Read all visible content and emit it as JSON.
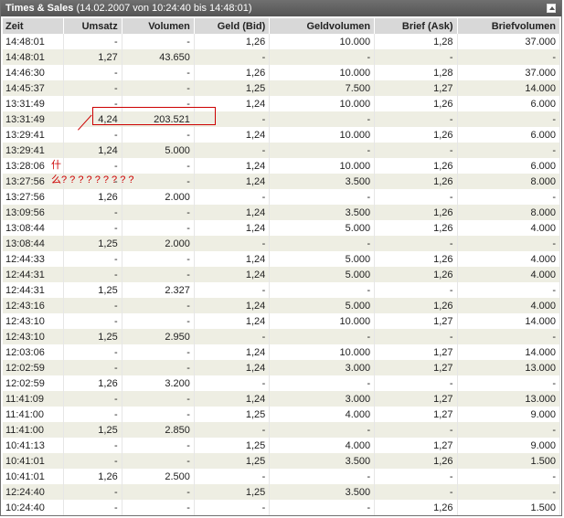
{
  "panel": {
    "title": "Times & Sales",
    "range": "(14.02.2007 von 10:24:40 bis 14:48:01)",
    "headers": [
      "Zeit",
      "Umsatz",
      "Volumen",
      "Geld (Bid)",
      "Geldvolumen",
      "Brief (Ask)",
      "Briefvolumen"
    ],
    "rows": [
      [
        "14:48:01",
        "-",
        "-",
        "1,26",
        "10.000",
        "1,28",
        "37.000"
      ],
      [
        "14:48:01",
        "1,27",
        "43.650",
        "-",
        "-",
        "-",
        "-"
      ],
      [
        "14:46:30",
        "-",
        "-",
        "1,26",
        "10.000",
        "1,28",
        "37.000"
      ],
      [
        "14:45:37",
        "-",
        "-",
        "1,25",
        "7.500",
        "1,27",
        "14.000"
      ],
      [
        "13:31:49",
        "-",
        "-",
        "1,24",
        "10.000",
        "1,26",
        "6.000"
      ],
      [
        "13:31:49",
        "4,24",
        "203.521",
        "-",
        "-",
        "-",
        "-"
      ],
      [
        "13:29:41",
        "-",
        "-",
        "1,24",
        "10.000",
        "1,26",
        "6.000"
      ],
      [
        "13:29:41",
        "1,24",
        "5.000",
        "-",
        "-",
        "-",
        "-"
      ],
      [
        "13:28:06",
        "-",
        "-",
        "1,24",
        "10.000",
        "1,26",
        "6.000"
      ],
      [
        "13:27:56",
        "-",
        "-",
        "1,24",
        "3.500",
        "1,26",
        "8.000"
      ],
      [
        "13:27:56",
        "1,26",
        "2.000",
        "-",
        "-",
        "-",
        "-"
      ],
      [
        "13:09:56",
        "-",
        "-",
        "1,24",
        "3.500",
        "1,26",
        "8.000"
      ],
      [
        "13:08:44",
        "-",
        "-",
        "1,24",
        "5.000",
        "1,26",
        "4.000"
      ],
      [
        "13:08:44",
        "1,25",
        "2.000",
        "-",
        "-",
        "-",
        "-"
      ],
      [
        "12:44:33",
        "-",
        "-",
        "1,24",
        "5.000",
        "1,26",
        "4.000"
      ],
      [
        "12:44:31",
        "-",
        "-",
        "1,24",
        "5.000",
        "1,26",
        "4.000"
      ],
      [
        "12:44:31",
        "1,25",
        "2.327",
        "-",
        "-",
        "-",
        "-"
      ],
      [
        "12:43:16",
        "-",
        "-",
        "1,24",
        "5.000",
        "1,26",
        "4.000"
      ],
      [
        "12:43:10",
        "-",
        "-",
        "1,24",
        "10.000",
        "1,27",
        "14.000"
      ],
      [
        "12:43:10",
        "1,25",
        "2.950",
        "-",
        "-",
        "-",
        "-"
      ],
      [
        "12:03:06",
        "-",
        "-",
        "1,24",
        "10.000",
        "1,27",
        "14.000"
      ],
      [
        "12:02:59",
        "-",
        "-",
        "1,24",
        "3.000",
        "1,27",
        "13.000"
      ],
      [
        "12:02:59",
        "1,26",
        "3.200",
        "-",
        "-",
        "-",
        "-"
      ],
      [
        "11:41:09",
        "-",
        "-",
        "1,24",
        "3.000",
        "1,27",
        "13.000"
      ],
      [
        "11:41:00",
        "-",
        "-",
        "1,25",
        "4.000",
        "1,27",
        "9.000"
      ],
      [
        "11:41:00",
        "1,25",
        "2.850",
        "-",
        "-",
        "-",
        "-"
      ],
      [
        "10:41:13",
        "-",
        "-",
        "1,25",
        "4.000",
        "1,27",
        "9.000"
      ],
      [
        "10:41:01",
        "-",
        "-",
        "1,25",
        "3.500",
        "1,26",
        "1.500"
      ],
      [
        "10:41:01",
        "1,26",
        "2.500",
        "-",
        "-",
        "-",
        "-"
      ],
      [
        "12:24:40",
        "-",
        "-",
        "1,25",
        "3.500",
        "-",
        "-"
      ],
      [
        "10:24:40",
        "-",
        "-",
        "-",
        "-",
        "1,26",
        "1.500"
      ]
    ]
  },
  "annotations": {
    "chinese_char": "什",
    "question_marks": "么? ? ? ? ? ? ? ? ?"
  },
  "colors": {
    "highlight": "#cc0000",
    "alt_row": "#eeeee3",
    "header_bg": "#d8d8d8"
  }
}
